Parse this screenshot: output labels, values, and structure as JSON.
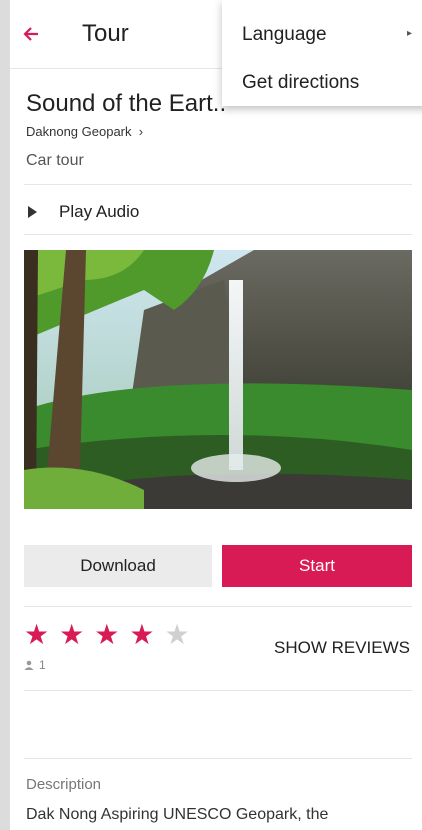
{
  "appbar": {
    "title": "Tour"
  },
  "menu": {
    "items": [
      "Language",
      "Get directions"
    ]
  },
  "tour": {
    "title": "Sound of the Eart..",
    "subtitle": "Daknong Geopark",
    "type": "Car tour",
    "play_audio": "Play Audio"
  },
  "actions": {
    "download": "Download",
    "start": "Start"
  },
  "rating": {
    "stars_filled": 4,
    "stars_total": 5,
    "reviewers": "1",
    "show_reviews": "SHOW REVIEWS"
  },
  "description": {
    "heading": "Description",
    "text": "Dak Nong Aspiring UNESCO Geopark, the"
  },
  "colors": {
    "accent": "#d81b55"
  }
}
